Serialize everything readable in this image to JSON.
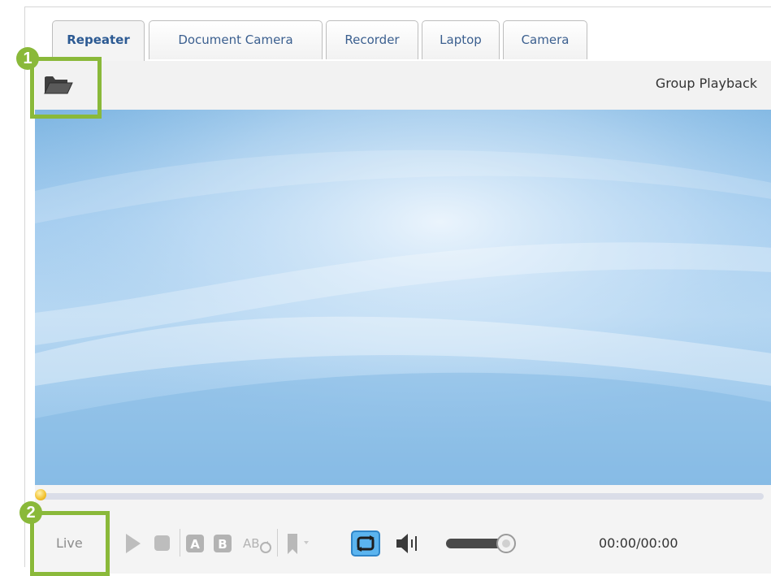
{
  "tabs": [
    {
      "label": "Repeater",
      "active": true
    },
    {
      "label": "Document Camera",
      "active": false
    },
    {
      "label": "Recorder",
      "active": false
    },
    {
      "label": "Laptop",
      "active": false
    },
    {
      "label": "Camera",
      "active": false
    }
  ],
  "toolbar": {
    "open_icon": "folder-open-icon",
    "group_playback_label": "Group Playback"
  },
  "playback": {
    "progress": 0,
    "live_label": "Live",
    "time": "00:00/00:00",
    "volume_level": 1.0,
    "controls": {
      "play_icon": "play-icon",
      "stop_icon": "stop-icon",
      "a_point_label": "A",
      "b_point_label": "B",
      "ab_repeat_icon": "ab-repeat-icon",
      "bookmark_icon": "bookmark-icon",
      "loop_icon": "loop-icon",
      "volume_icon": "speaker-icon"
    }
  },
  "callouts": {
    "one": "1",
    "two": "2"
  },
  "colors": {
    "callout_green": "#8ab93a",
    "tab_text": "#3b5f8f",
    "progress_thumb": "#f2c12e",
    "loop_active": "#3a9be0"
  }
}
